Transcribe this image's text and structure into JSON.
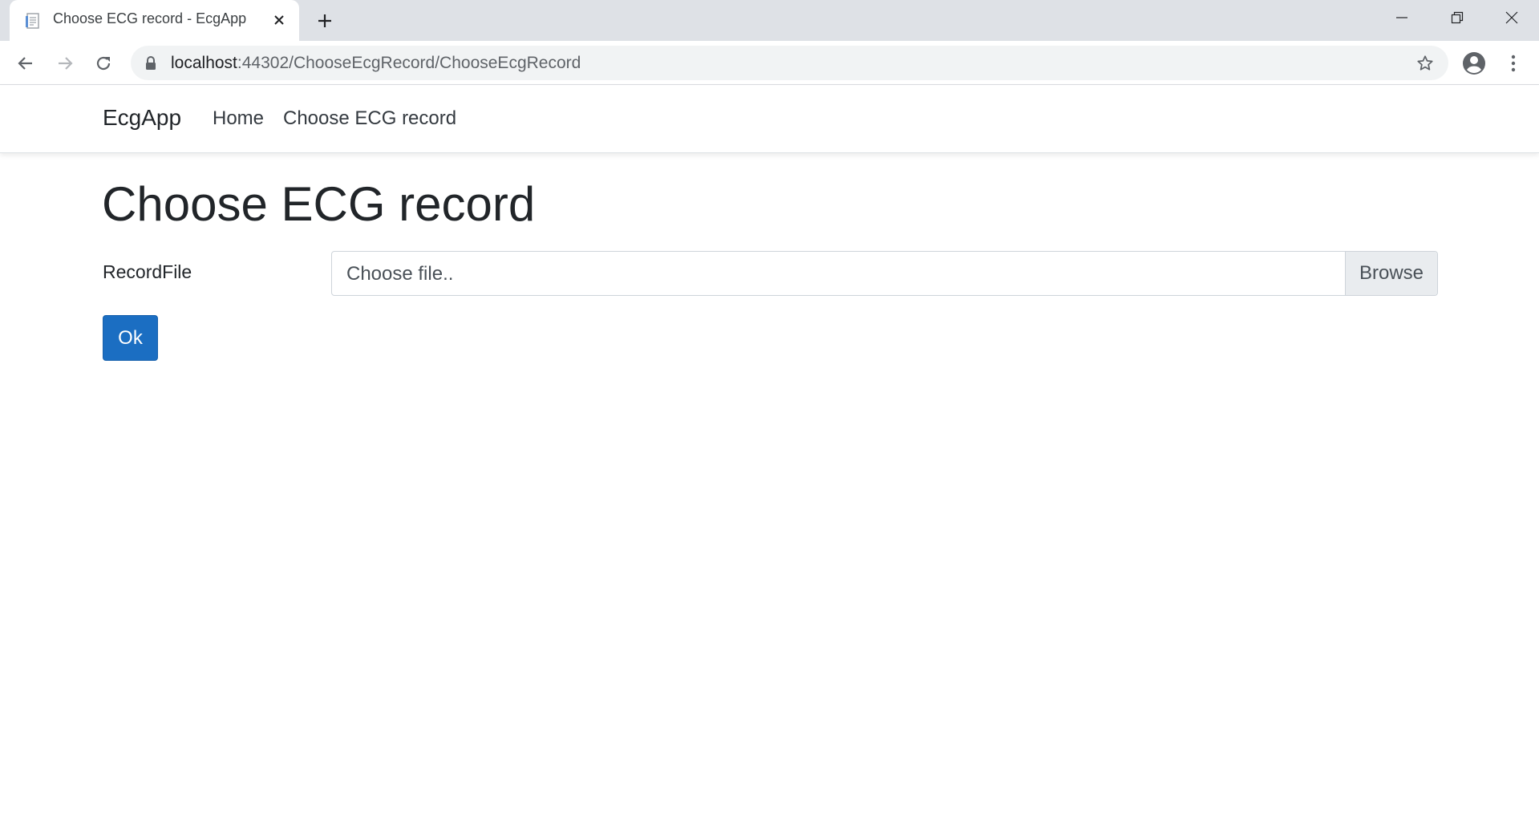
{
  "browser": {
    "tab": {
      "title": "Choose ECG record - EcgApp",
      "icon": "document-favicon-icon"
    },
    "address_bar": {
      "host": "localhost",
      "path": ":44302/ChooseEcgRecord/ChooseEcgRecord"
    }
  },
  "navbar": {
    "brand": "EcgApp",
    "links": [
      {
        "label": "Home"
      },
      {
        "label": "Choose ECG record"
      }
    ]
  },
  "main": {
    "title": "Choose ECG record",
    "form": {
      "field_label": "RecordFile",
      "file_placeholder": "Choose file..",
      "browse_label": "Browse",
      "submit_label": "Ok"
    }
  },
  "colors": {
    "primary_button": "#1b6ec2",
    "tabstrip": "#dee1e6",
    "omnibox": "#f1f3f4"
  }
}
